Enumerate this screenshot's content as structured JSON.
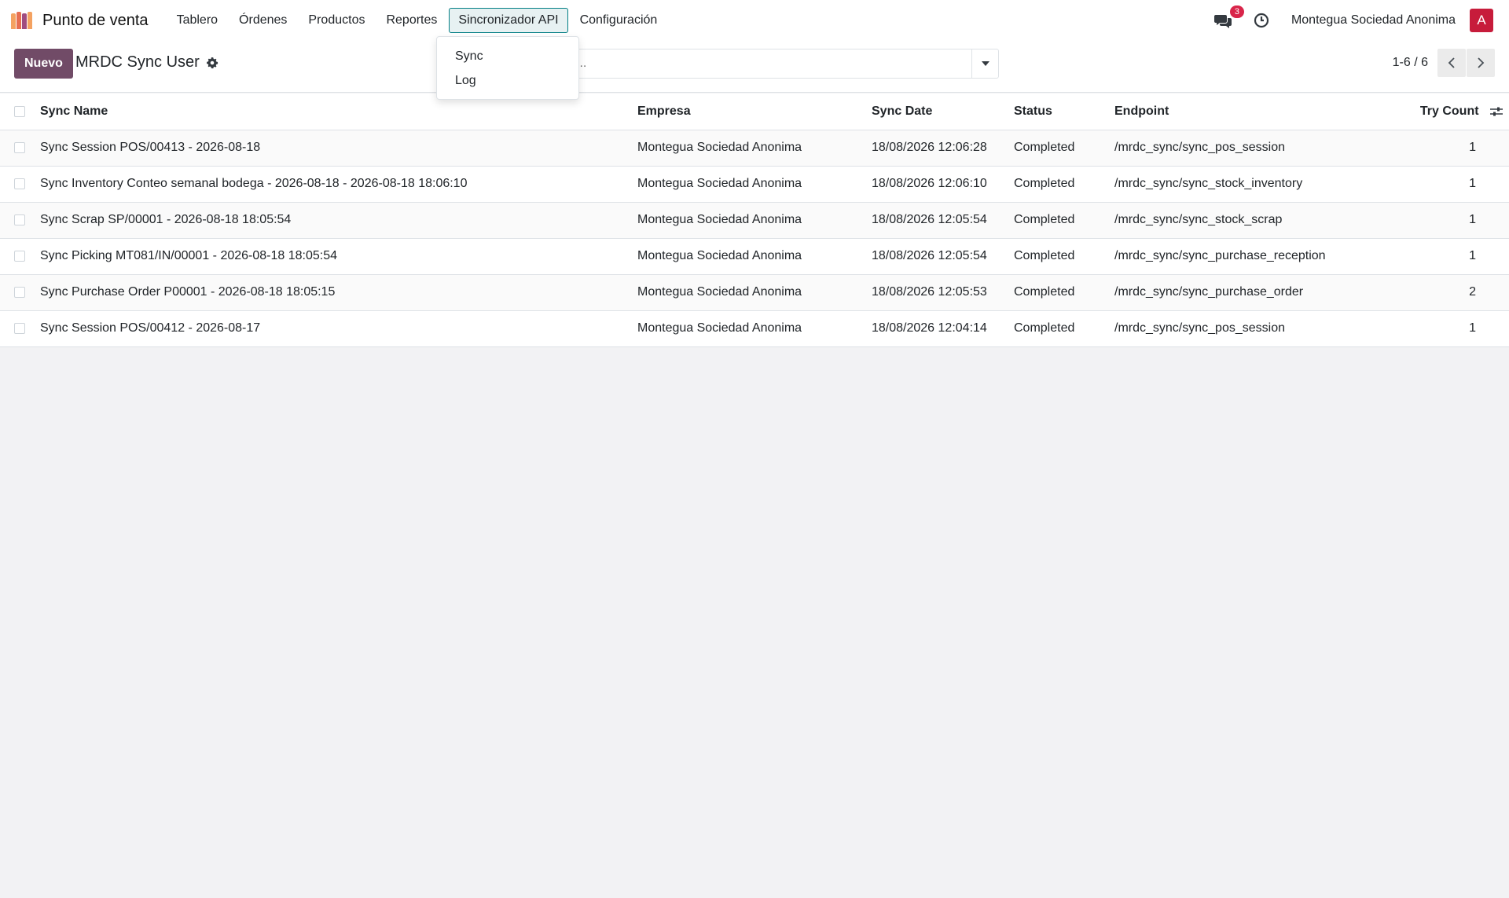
{
  "navbar": {
    "app_name": "Punto de venta",
    "menus": [
      "Tablero",
      "Órdenes",
      "Productos",
      "Reportes",
      "Sincronizador API",
      "Configuración"
    ],
    "active_menu": "Sincronizador API",
    "notification_count": "3",
    "company": "Montegua Sociedad Anonima",
    "avatar_letter": "A",
    "avatar_color": "#c71c3b"
  },
  "dropdown": {
    "items": [
      "Sync",
      "Log"
    ]
  },
  "control": {
    "new_label": "Nuevo",
    "title": "MRDC Sync User",
    "search_placeholder": "...",
    "pager": "1-6 / 6"
  },
  "table": {
    "headers": [
      "Sync Name",
      "Empresa",
      "Sync Date",
      "Status",
      "Endpoint",
      "Try Count"
    ],
    "rows": [
      [
        "Sync Session POS/00413 - 2026-08-18",
        "Montegua Sociedad Anonima",
        "18/08/2026 12:06:28",
        "Completed",
        "/mrdc_sync/sync_pos_session",
        "1"
      ],
      [
        "Sync Inventory Conteo semanal bodega - 2026-08-18 - 2026-08-18 18:06:10",
        "Montegua Sociedad Anonima",
        "18/08/2026 12:06:10",
        "Completed",
        "/mrdc_sync/sync_stock_inventory",
        "1"
      ],
      [
        "Sync Scrap SP/00001 - 2026-08-18 18:05:54",
        "Montegua Sociedad Anonima",
        "18/08/2026 12:05:54",
        "Completed",
        "/mrdc_sync/sync_stock_scrap",
        "1"
      ],
      [
        "Sync Picking MT081/IN/00001 - 2026-08-18 18:05:54",
        "Montegua Sociedad Anonima",
        "18/08/2026 12:05:54",
        "Completed",
        "/mrdc_sync/sync_purchase_reception",
        "1"
      ],
      [
        "Sync Purchase Order P00001 - 2026-08-18 18:05:15",
        "Montegua Sociedad Anonima",
        "18/08/2026 12:05:53",
        "Completed",
        "/mrdc_sync/sync_purchase_order",
        "2"
      ],
      [
        "Sync Session POS/00412 - 2026-08-17",
        "Montegua Sociedad Anonima",
        "18/08/2026 12:04:14",
        "Completed",
        "/mrdc_sync/sync_pos_session",
        "1"
      ]
    ]
  },
  "icons": {
    "brand": "pos-logo-icon",
    "chat": "chat-icon",
    "activity": "clock-icon",
    "settings": "gear-icon",
    "search_toggle": "caret-down-icon",
    "prev": "chevron-left-icon",
    "next": "chevron-right-icon",
    "optional_columns": "sliders-icon"
  }
}
